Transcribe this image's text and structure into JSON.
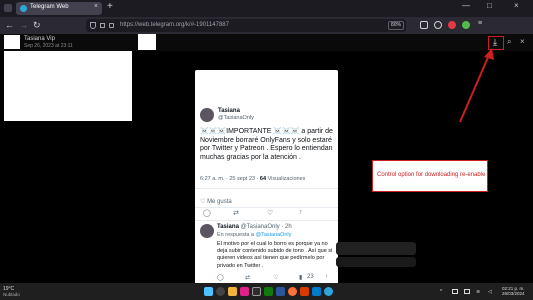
{
  "browser": {
    "tab_title": "Telegram Web",
    "tab_close": "×",
    "new_tab": "+",
    "url": "https://web.telegram.org/k/#-1901147887",
    "zoom": "80%",
    "window_controls": [
      "—",
      "□",
      "×"
    ]
  },
  "viewer": {
    "sender_name": "Tasiana Vip",
    "sender_date": "Sep 26, 2023 at 23:11",
    "close_icon": "×"
  },
  "tweet": {
    "author_name": "Tasiana",
    "author_handle": "@TasianaOnly",
    "text": "☠️☠️☠️IMPORTANTE ☠️☠️☠️ a partir de Noviembre borraré OnlyFans y solo estaré por Twitter y Patreon . Espero lo entiendan muchas gracias por la atención .",
    "meta_prefix": "6:27 a. m. · 25 sept 23 · ",
    "views_count": "64",
    "views_label": " Visualizaciones",
    "like_label": "Me gusta",
    "reply": {
      "author_name": "Tasiana",
      "author_handle": "@TasianaOnly · 2h",
      "reply_prefix": "En respuesta a ",
      "reply_handle": "@TasianaOnly",
      "text": "El motivo por el cual lo borro es porque ya no deja subir contenido subido de tono . Así que si quieren videos así tienen que pedírmelo por privado en Twitter .",
      "like_count": "23"
    }
  },
  "annotation": {
    "callout_text": "Control option for downloading re-enable"
  },
  "taskbar": {
    "weather_temp": "19°C",
    "weather_desc": "Nublado",
    "time": "02:21 p. m.",
    "date": "26/03/2024"
  },
  "colors": {
    "accent_red": "#cc1f1f",
    "telegram_blue": "#2ea6dc",
    "twitter_blue": "#1d9bf0"
  }
}
